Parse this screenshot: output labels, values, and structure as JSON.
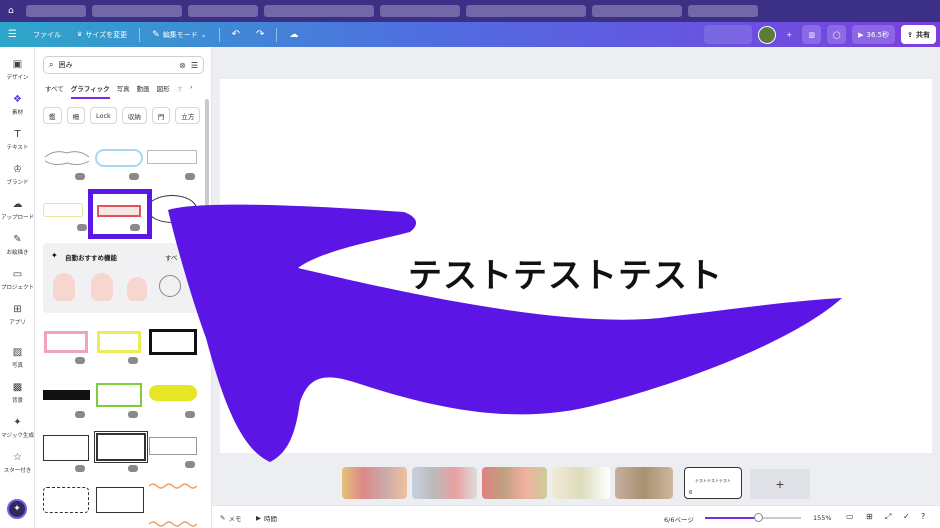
{
  "topbar": {
    "menu_icon": "hamburger-icon",
    "file_label": "ファイル",
    "resize_label": "サイズを変更",
    "edit_mode_label": "編集モード",
    "timer_label": "36.5秒",
    "share_label": "共有"
  },
  "rail": {
    "items": [
      {
        "label": "デザイン",
        "icon": "layout-icon"
      },
      {
        "label": "素材",
        "icon": "elements-icon"
      },
      {
        "label": "テキスト",
        "icon": "text-icon"
      },
      {
        "label": "ブランド",
        "icon": "brand-icon"
      },
      {
        "label": "アップロード",
        "icon": "upload-icon"
      },
      {
        "label": "お絵描き",
        "icon": "draw-icon"
      },
      {
        "label": "プロジェクト",
        "icon": "folder-icon"
      },
      {
        "label": "アプリ",
        "icon": "apps-icon"
      },
      {
        "label": "写真",
        "icon": "photo-icon"
      },
      {
        "label": "背景",
        "icon": "background-icon"
      },
      {
        "label": "マジック生成",
        "icon": "magic-icon"
      },
      {
        "label": "スター付き",
        "icon": "star-icon"
      }
    ]
  },
  "panel": {
    "search_value": "囲み",
    "tabs": [
      "すべて",
      "グラフィック",
      "写真",
      "動画",
      "図形",
      "オ"
    ],
    "active_tab": "グラフィック",
    "chips": [
      "鑑",
      "柵",
      "Lock",
      "収納",
      "門",
      "立方"
    ],
    "ai_title": "自動おすすめ機能",
    "ai_more": "すべ"
  },
  "canvas": {
    "text": "テストテストテスト",
    "arrow_color": "#5b16e6",
    "highlight_color": "#5a16e6"
  },
  "thumbs": {
    "current_page_number": "6",
    "current_page_text": "テストテストテスト",
    "add_label": "+"
  },
  "bottombar": {
    "notes_label": "メモ",
    "timer_label": "時間",
    "page_label": "6/6ページ",
    "zoom_label": "155%",
    "zoom_level": 0.55
  }
}
